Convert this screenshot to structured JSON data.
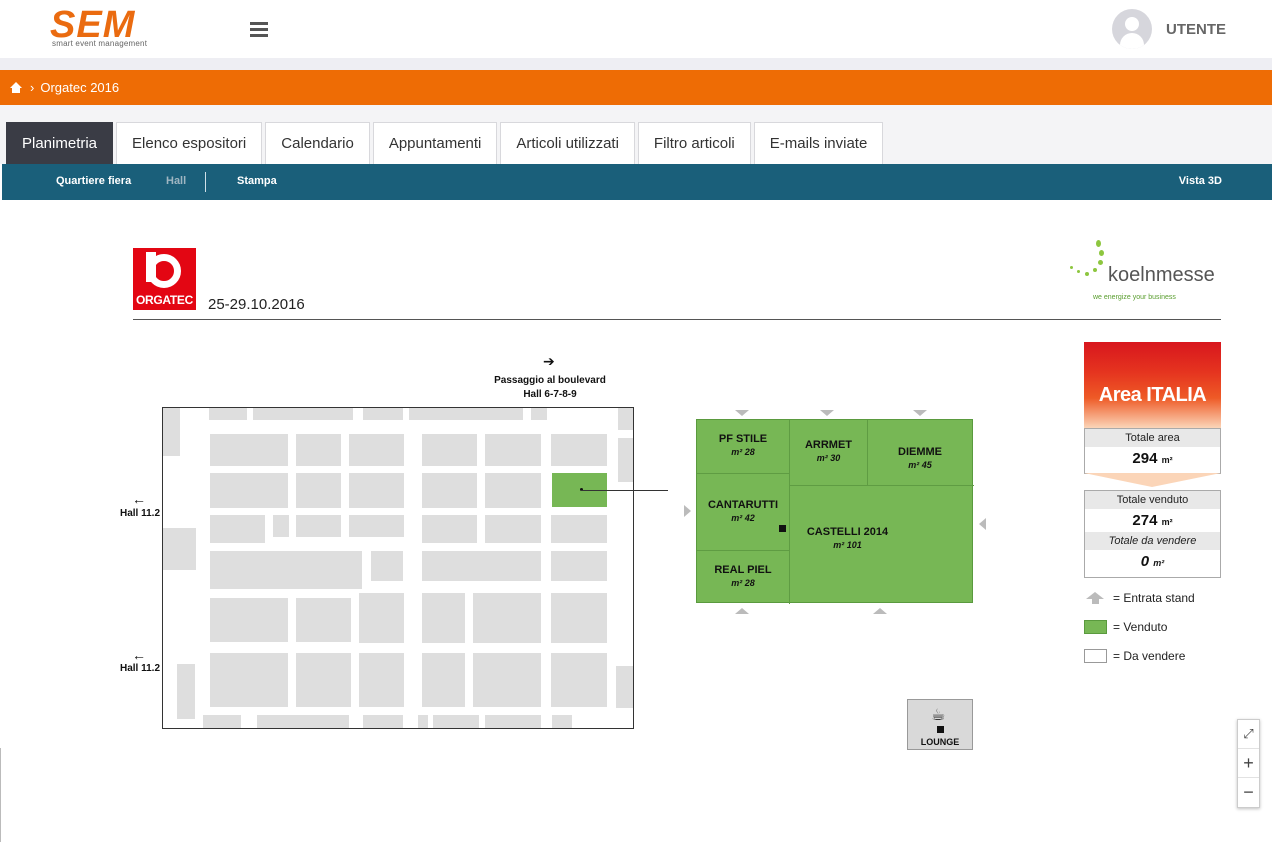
{
  "header": {
    "logo_text": "SEM",
    "logo_subtitle": "smart event management",
    "user_label": "UTENTE"
  },
  "breadcrumb": {
    "current": "Orgatec 2016"
  },
  "tabs": [
    {
      "label": "Planimetria",
      "active": true
    },
    {
      "label": "Elenco espositori"
    },
    {
      "label": "Calendario"
    },
    {
      "label": "Appuntamenti"
    },
    {
      "label": "Articoli utilizzati"
    },
    {
      "label": "Filtro articoli"
    },
    {
      "label": "E-mails inviate"
    }
  ],
  "subnav": {
    "quartiere": "Quartiere fiera",
    "hall": "Hall",
    "stampa": "Stampa",
    "vista3d": "Vista 3D"
  },
  "event": {
    "logo_text": "ORGATEC",
    "dates": "25-29.10.2016",
    "partner_name": "koelnmesse",
    "partner_tagline": "we energize your business"
  },
  "plan": {
    "passage_line1": "Passaggio al boulevard",
    "passage_line2": "Hall 6-7-8-9",
    "left_top": "Hall 11.2",
    "left_bottom": "Hall 11.2"
  },
  "stands": [
    {
      "name": "PF STILE",
      "area": "m² 28"
    },
    {
      "name": "ARRMET",
      "area": "m² 30"
    },
    {
      "name": "DIEMME",
      "area": "m² 45"
    },
    {
      "name": "CANTARUTTI",
      "area": "m² 42"
    },
    {
      "name": "CASTELLI 2014",
      "area": "m² 101"
    },
    {
      "name": "REAL PIEL",
      "area": "m² 28"
    }
  ],
  "lounge_label": "LOUNGE",
  "panel": {
    "title": "Area ITALIA",
    "totale_area_label": "Totale area",
    "totale_area_value": "294",
    "totale_venduto_label": "Totale venduto",
    "totale_venduto_value": "274",
    "totale_da_vendere_label": "Totale da vendere",
    "totale_da_vendere_value": "0",
    "unit": "m²"
  },
  "legend": {
    "entrata": "= Entrata stand",
    "venduto": "= Venduto",
    "da_vendere": "= Da vendere"
  },
  "colors": {
    "brand_orange": "#ee6c05",
    "subnav_teal": "#1a5f7a",
    "sold_green": "#77b755",
    "orgatec_red": "#e30613"
  }
}
